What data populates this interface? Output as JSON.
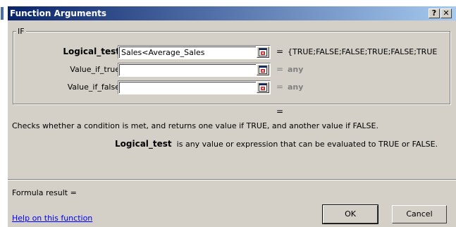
{
  "dialog": {
    "title": "Function Arguments",
    "help_button": "?",
    "close_button": "✕"
  },
  "function_group": {
    "name": "IF",
    "arguments": [
      {
        "label": "Logical_test",
        "value": "Sales<Average_Sales",
        "equals": "=",
        "result": "{TRUE;FALSE;FALSE;TRUE;FALSE;TRUE",
        "bold": true
      },
      {
        "label": "Value_if_true",
        "value": "",
        "equals": "=",
        "result": "any",
        "bold": false
      },
      {
        "label": "Value_if_false",
        "value": "",
        "equals": "=",
        "result": "any",
        "bold": false
      }
    ]
  },
  "result_equals": "=",
  "description": "Checks whether a condition is met, and returns one value if TRUE, and another value if FALSE.",
  "argument_help": {
    "name": "Logical_test",
    "text": "is any value or expression that can be evaluated to TRUE or FALSE."
  },
  "formula_result": "Formula result =",
  "help_link": "Help on this function",
  "buttons": {
    "ok": "OK",
    "cancel": "Cancel"
  },
  "icons": {
    "ref_button": "collapse-dialog-icon"
  },
  "colors": {
    "title_start": "#0a246a",
    "title_end": "#a6caf0",
    "dialog_bg": "#d4d0c8",
    "link": "#0000ff"
  }
}
